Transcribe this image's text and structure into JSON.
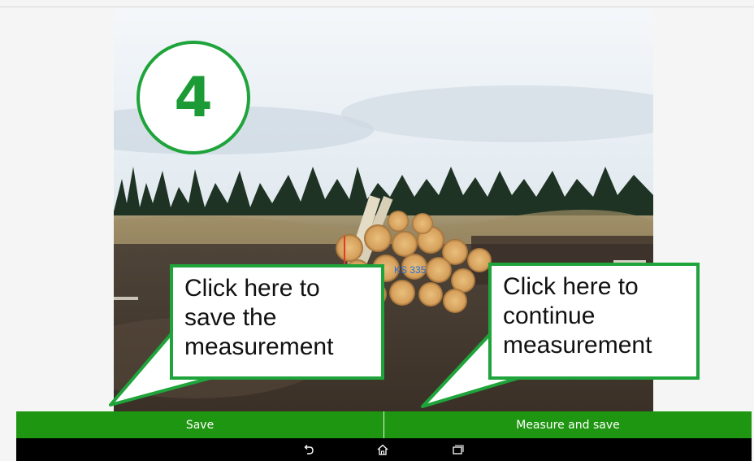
{
  "step": {
    "number": "4"
  },
  "callouts": {
    "left": "Click  here  to\nsave  the\nmeasurement",
    "right": "Click  here to\ncontinue\nmeasurement"
  },
  "actions": {
    "save_label": "Save",
    "measure_save_label": "Measure and save"
  },
  "navigation": {
    "icons": [
      "back-icon",
      "home-icon",
      "recent-apps-icon"
    ]
  },
  "colors": {
    "accent_green": "#1ea43a",
    "action_bar": "#1f9611",
    "nav_bar": "#000000"
  }
}
